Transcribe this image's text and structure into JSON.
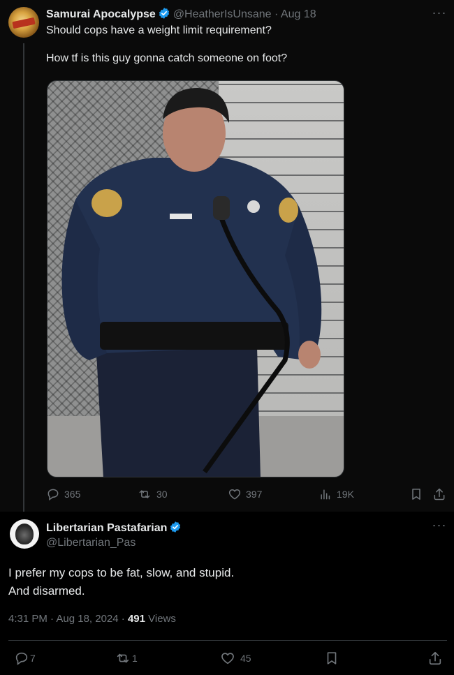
{
  "parent_tweet": {
    "author_name": "Samurai Apocalypse",
    "handle": "@HeatherIsUnsane",
    "separator": "·",
    "date": "Aug 18",
    "text": "Should cops have a weight limit requirement?\n\nHow tf is this guy gonna catch someone on foot?",
    "stats": {
      "replies": "365",
      "reposts": "30",
      "likes": "397",
      "views": "19K"
    }
  },
  "reply_tweet": {
    "author_name": "Libertarian Pastafarian",
    "handle": "@Libertarian_Pas",
    "text": "I prefer my cops to be fat, slow, and stupid.\nAnd disarmed.",
    "timestamp": "4:31 PM · Aug 18, 2024 · ",
    "views_count": "491",
    "views_label": " Views",
    "stats": {
      "replies": "7",
      "reposts": "1",
      "likes": "45"
    }
  },
  "icons": {
    "verified": "verified-badge-icon",
    "more": "more-dots-icon",
    "reply": "reply-bubble-icon",
    "repost": "repost-arrows-icon",
    "like": "heart-icon",
    "views": "bar-chart-icon",
    "bookmark": "bookmark-icon",
    "share": "share-upload-icon"
  },
  "colors": {
    "background": "#000000",
    "parent_background": "#0a0a0a",
    "text": "#e7e9ea",
    "muted": "#71767b",
    "verified": "#1d9bf0",
    "divider": "#2f3336"
  }
}
